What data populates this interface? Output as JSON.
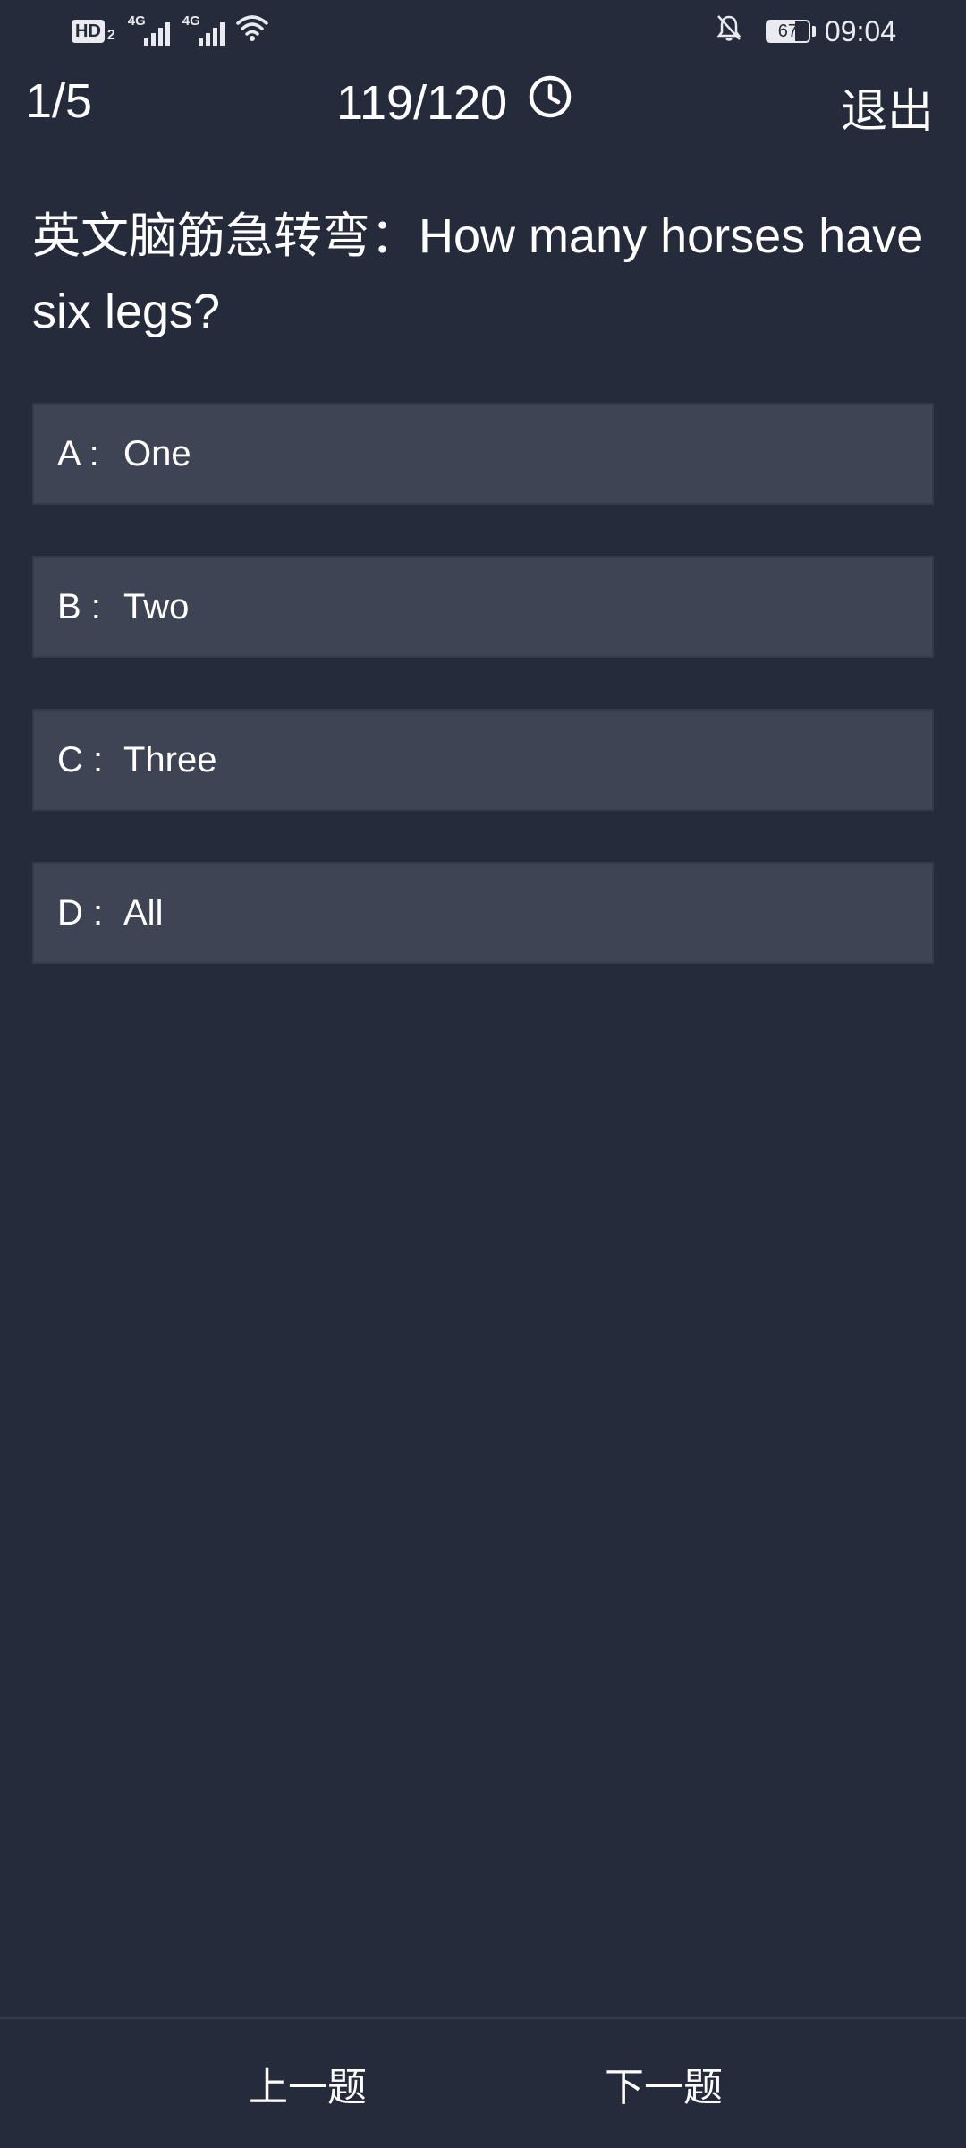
{
  "status_bar": {
    "hd_label": "HD",
    "hd_sub": "2",
    "network_1": "4G",
    "network_2": "4G",
    "battery_level": "67",
    "time": "09:04",
    "icons": [
      "wifi-icon",
      "bell-muted-icon",
      "battery-icon"
    ]
  },
  "header": {
    "progress": "1/5",
    "timer": "119/120",
    "exit_label": "退出"
  },
  "question": {
    "text": "英文脑筋急转弯：How many horses have six legs?"
  },
  "options": [
    {
      "key": "A :",
      "text": "One"
    },
    {
      "key": "B :",
      "text": "Two"
    },
    {
      "key": "C :",
      "text": "Three"
    },
    {
      "key": "D :",
      "text": "All"
    }
  ],
  "footer": {
    "prev_label": "上一题",
    "next_label": "下一题"
  },
  "colors": {
    "background": "#262b3b",
    "option_background": "#3f4454",
    "text": "#ffffff"
  }
}
